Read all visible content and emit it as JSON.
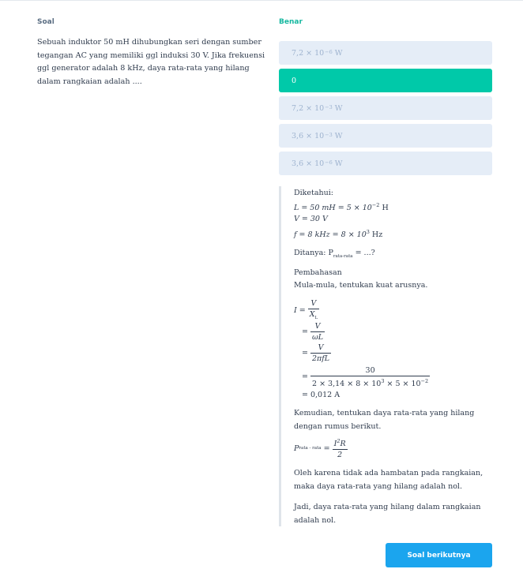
{
  "left": {
    "label": "Soal",
    "question": "Sebuah induktor 50 mH dihubungkan seri dengan sumber tegangan AC yang memiliki ggl induksi 30 V. Jika frekuensi ggl generator adalah 8 kHz, daya rata-rata yang hilang dalam rangkaian adalah ...."
  },
  "right": {
    "label": "Benar",
    "options": [
      {
        "mantissa": "7,2",
        "times": "×",
        "base": "10",
        "exp": "−6",
        "unit": "W",
        "state": "default"
      },
      {
        "text": "0",
        "state": "correct"
      },
      {
        "mantissa": "7,2",
        "times": "×",
        "base": "10",
        "exp": "−3",
        "unit": "W",
        "state": "default"
      },
      {
        "mantissa": "3,6",
        "times": "×",
        "base": "10",
        "exp": "−3",
        "unit": "W",
        "state": "default"
      },
      {
        "mantissa": "3,6",
        "times": "×",
        "base": "10",
        "exp": "−6",
        "unit": "W",
        "state": "default"
      }
    ]
  },
  "explanation": {
    "known_title": "Diketahui:",
    "known_L": "L = 50 mH = 5 × 10",
    "known_L_exp": "−2",
    "known_L_unit": " H",
    "known_V": "V = 30 V",
    "known_f": "f = 8 kHz = 8 × 10",
    "known_f_exp": "3",
    "known_f_unit": " Hz",
    "asked_prefix": "Ditanya: P",
    "asked_sub": "rata-rata",
    "asked_suffix": " = ...?",
    "discussion_title": "Pembahasan",
    "step1": "Mula-mula, tentukan kuat arusnya.",
    "calc": {
      "lhs": "I =",
      "f1_num": "V",
      "f1_den": "X",
      "f1_den_sub": "L",
      "f2_num": "V",
      "f2_den": "ωL",
      "f3_num": "V",
      "f3_den": "2πfL",
      "f4_num": "30",
      "f4_den": "2 × 3,14 × 8 × 10",
      "f4_den_exp1": "3",
      "f4_den_mid": " × 5 × 10",
      "f4_den_exp2": "−2",
      "eq": "=",
      "result": "= 0,012 A"
    },
    "step2": "Kemudian, tentukan daya rata-rata yang hilang dengan rumus berikut.",
    "power": {
      "lhs": "P",
      "lhs_sub": "rata - rata",
      "eq": "=",
      "num": "I",
      "num_exp": "2",
      "num_tail": "R",
      "den": "2"
    },
    "step3": "Oleh karena tidak ada hambatan pada rangkaian, maka daya rata-rata yang hilang adalah nol.",
    "conclusion": "Jadi, daya rata-rata yang hilang dalam rangkaian adalah nol."
  },
  "footer": {
    "next_label": "Soal berikutnya"
  },
  "colors": {
    "correct": "#00c9a9",
    "option_bg": "#e5edf7",
    "button": "#1ba5ee",
    "correct_label": "#16b8a0"
  }
}
